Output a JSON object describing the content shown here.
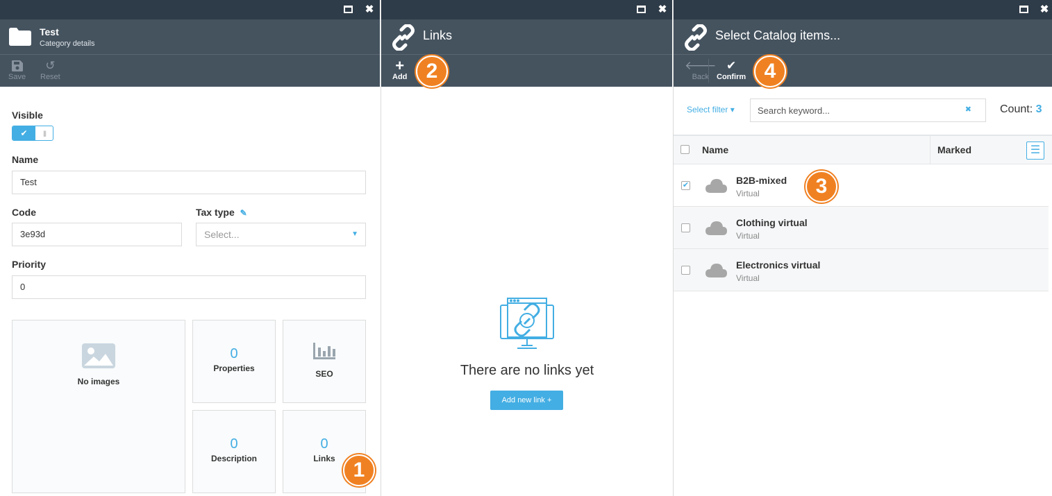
{
  "blade1": {
    "title": "Test",
    "subtitle": "Category details",
    "toolbar": {
      "save": "Save",
      "reset": "Reset"
    },
    "visible_label": "Visible",
    "visible_on": true,
    "name_label": "Name",
    "name_value": "Test",
    "code_label": "Code",
    "code_value": "3e93d",
    "tax_label": "Tax type",
    "tax_placeholder": "Select...",
    "priority_label": "Priority",
    "priority_value": "0",
    "images_label": "No images",
    "tiles": {
      "properties": {
        "count": "0",
        "label": "Properties"
      },
      "seo": {
        "label": "SEO"
      },
      "description": {
        "count": "0",
        "label": "Description"
      },
      "links": {
        "count": "0",
        "label": "Links"
      }
    },
    "badge": "1"
  },
  "blade2": {
    "title": "Links",
    "toolbar": {
      "add": "Add"
    },
    "badge": "2",
    "empty_title": "There are no links yet",
    "add_link_button": "Add new link +"
  },
  "blade3": {
    "title": "Select Catalog items...",
    "toolbar": {
      "back": "Back",
      "confirm": "Confirm"
    },
    "badge_confirm": "4",
    "badge_row": "3",
    "filter_label": "Select filter ▾",
    "search_placeholder": "Search keyword...",
    "count_label": "Count:",
    "count_value": "3",
    "columns": {
      "name": "Name",
      "marked": "Marked"
    },
    "rows": [
      {
        "name": "B2B-mixed",
        "type": "Virtual",
        "checked": true
      },
      {
        "name": "Clothing virtual",
        "type": "Virtual",
        "checked": false
      },
      {
        "name": "Electronics virtual",
        "type": "Virtual",
        "checked": false
      }
    ]
  },
  "colors": {
    "accent": "#43aee3",
    "header": "#45535f",
    "winbar": "#2e3b48",
    "badge": "#f08122"
  },
  "icons": [
    "folder-icon",
    "save-icon",
    "reset-icon",
    "link-icon",
    "plus-icon",
    "back-arrow-icon",
    "check-icon",
    "cloud-icon",
    "image-icon",
    "bar-chart-icon",
    "pencil-icon",
    "maximize-icon",
    "close-icon",
    "menu-icon",
    "clear-icon"
  ]
}
